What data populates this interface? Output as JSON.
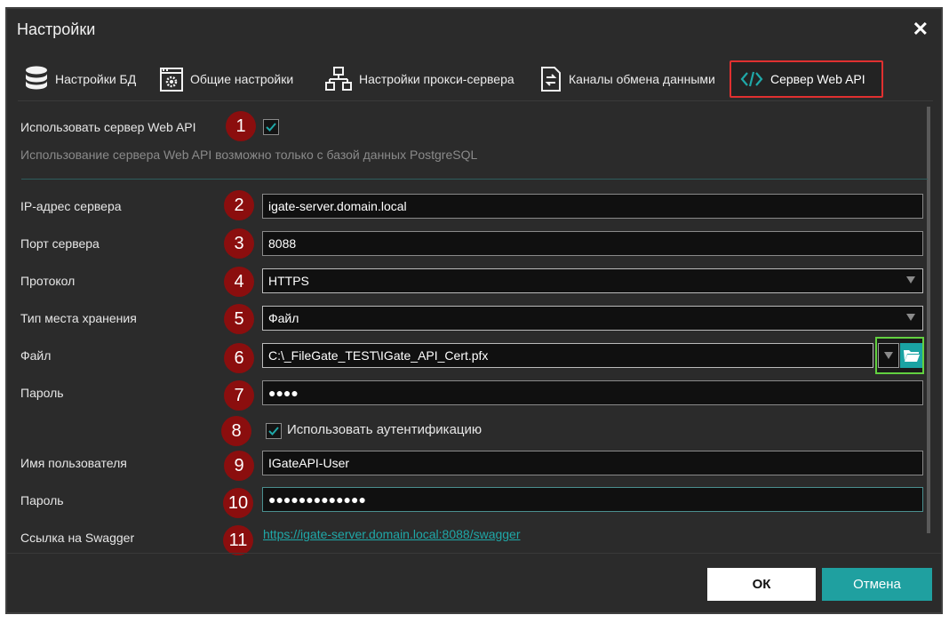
{
  "window": {
    "title": "Настройки",
    "close_symbol": "✕"
  },
  "tabs": [
    {
      "label": "Настройки БД",
      "icon": "database-icon"
    },
    {
      "label": "Общие настройки",
      "icon": "window-gear-icon"
    },
    {
      "label": "Настройки прокси-сервера",
      "icon": "network-icon"
    },
    {
      "label": "Каналы обмена данными",
      "icon": "document-exchange-icon"
    },
    {
      "label": "Сервер Web API",
      "icon": "code-icon",
      "active": true
    }
  ],
  "webapi": {
    "enable_label": "Использовать сервер Web API",
    "enabled": true,
    "hint": "Использование сервера Web API возможно только с базой данных PostgreSQL"
  },
  "badges": [
    "1",
    "2",
    "3",
    "4",
    "5",
    "6",
    "7",
    "8",
    "9",
    "10",
    "11"
  ],
  "fields": {
    "ip": {
      "label": "IP-адрес сервера",
      "value": "igate-server.domain.local"
    },
    "port": {
      "label": "Порт сервера",
      "value": "8088"
    },
    "protocol": {
      "label": "Протокол",
      "value": "HTTPS"
    },
    "storage": {
      "label": "Тип места хранения",
      "value": "Файл"
    },
    "file": {
      "label": "Файл",
      "value": "C:\\_FileGate_TEST\\IGate_API_Cert.pfx"
    },
    "cert_password": {
      "label": "Пароль",
      "value": "●●●●"
    },
    "auth": {
      "label": "Использовать аутентификацию",
      "checked": true
    },
    "username": {
      "label": "Имя пользователя",
      "value": "IGateAPI-User"
    },
    "user_password": {
      "label": "Пароль",
      "value": "●●●●●●●●●●●●●"
    },
    "swagger": {
      "label": "Ссылка на Swagger",
      "url": "https://igate-server.domain.local:8088/swagger"
    }
  },
  "buttons": {
    "ok": "ОК",
    "cancel": "Отмена"
  },
  "colors": {
    "accent": "#1fa0a0",
    "badge": "#8b0e0e",
    "active_tab_border": "#e03030",
    "file_buttons_border": "#62d040",
    "background": "#2b2b2b"
  }
}
